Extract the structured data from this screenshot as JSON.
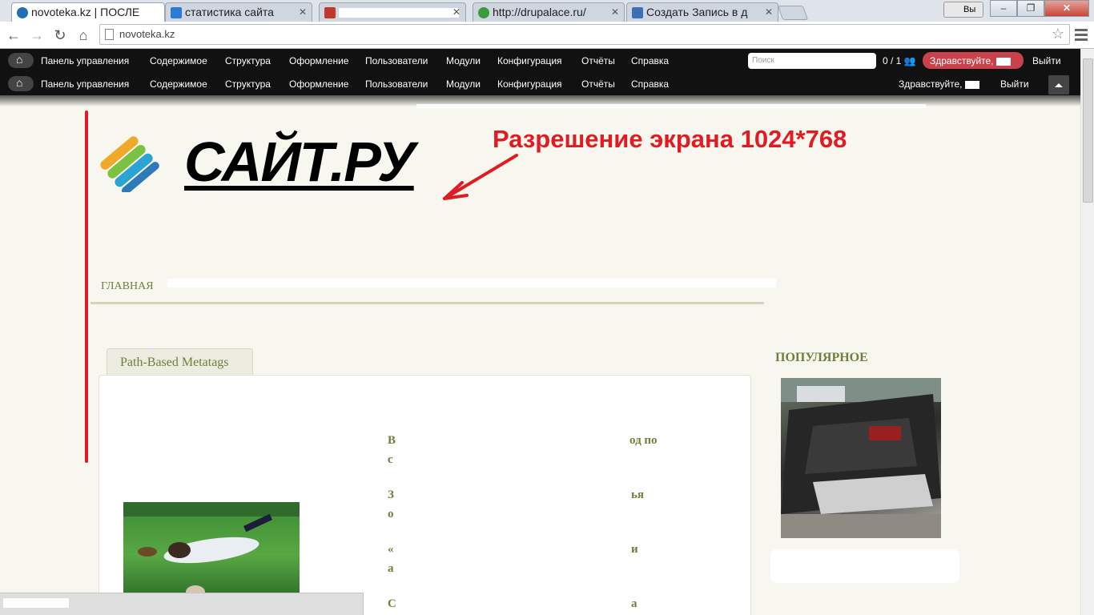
{
  "browser": {
    "tabs": [
      {
        "title": "novoteka.kz | ПОСЛЕ",
        "favicon_color": "#1f6fb8",
        "active": true
      },
      {
        "title": "статистика сайта",
        "favicon_color": "#2b7bd6"
      },
      {
        "title": "",
        "favicon_color": "#c0392b"
      },
      {
        "title": "http://drupalace.ru/",
        "favicon_color": "#3a9c3a"
      },
      {
        "title": "Создать Запись в д",
        "favicon_color": "#3b6fb6"
      }
    ],
    "user_badge": "Вы",
    "window_buttons": {
      "minimize": "–",
      "maximize": "❐",
      "close": "✕"
    },
    "address": "novoteka.kz",
    "nav": {
      "back": "←",
      "forward": "→",
      "reload": "↻",
      "home": "⌂",
      "star": "☆"
    }
  },
  "admin_toolbar": {
    "items": [
      "Панель управления",
      "Содержимое",
      "Структура",
      "Оформление",
      "Пользователи",
      "Модули",
      "Конфигурация",
      "Отчёты",
      "Справка"
    ],
    "search_placeholder": "Поиск",
    "count": "0 / 1",
    "greeting": "Здравствуйте,",
    "logout": "Выйти"
  },
  "admin_toolbar_2": {
    "items": [
      "Панель управления",
      "Содержимое",
      "Структура",
      "Оформление",
      "Пользователи",
      "Модули",
      "Конфигурация",
      "Отчёты",
      "Справка"
    ],
    "greeting": "Здравствуйте,",
    "logout": "Выйти"
  },
  "site": {
    "logo_text": "САЙТ.РУ",
    "annotation": "Разрешение экрана  1024*768",
    "annotation_color": "#e11b22",
    "main_menu": [
      "ГЛАВНАЯ"
    ],
    "tab_label": "Path-Based Metatags",
    "article_text_lines": [
      "В",
      "од по",
      "с",
      "З",
      "ья",
      "о",
      "«",
      "и",
      "а",
      "С",
      "а"
    ],
    "sidebar_title": "ПОПУЛЯРНОЕ",
    "accent_color": "#6f7f3b"
  }
}
